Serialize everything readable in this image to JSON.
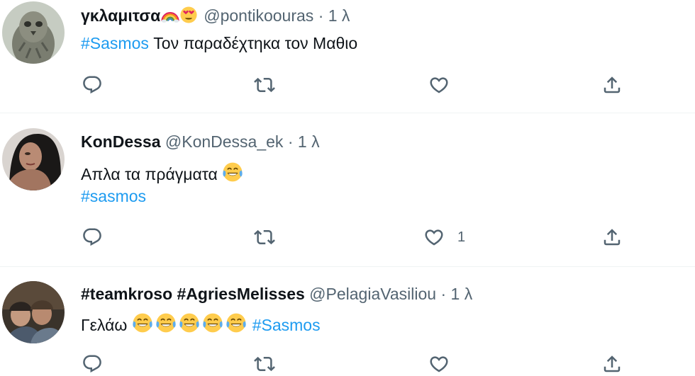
{
  "tweets": [
    {
      "name": "γκλαμιτσα",
      "handle": "@pontikoouras",
      "separator": "·",
      "time": "1 λ",
      "lines": [
        {
          "hashtag": "#Sasmos",
          "text": " Τον παραδέχτηκα τον Μαθιο"
        }
      ],
      "like_count": ""
    },
    {
      "name": "KonDessa",
      "handle": "@KonDessa_ek",
      "separator": "·",
      "time": "1 λ",
      "lines": [
        {
          "text": "Απλα τα πράγματα"
        },
        {
          "hashtag": "#sasmos"
        }
      ],
      "like_count": "1"
    },
    {
      "name": "#teamkroso #AgriesMelisses",
      "handle": "@PelagiaVasiliou",
      "separator": "·",
      "time": "1 λ",
      "lines": [
        {
          "text": "Γελάω",
          "hashtag": "#Sasmos"
        }
      ],
      "like_count": ""
    }
  ],
  "icons": {
    "reply": "reply-icon",
    "retweet": "retweet-icon",
    "like": "like-icon",
    "share": "share-icon",
    "emoji_rainbow": "rainbow-emoji-icon",
    "emoji_heart_eyes": "heart-eyes-emoji-icon",
    "emoji_tears_of_joy": "tears-of-joy-emoji-icon"
  },
  "colors": {
    "hashtag": "#1d9bf0",
    "secondary_text": "#536471",
    "divider": "#eff3f4"
  }
}
